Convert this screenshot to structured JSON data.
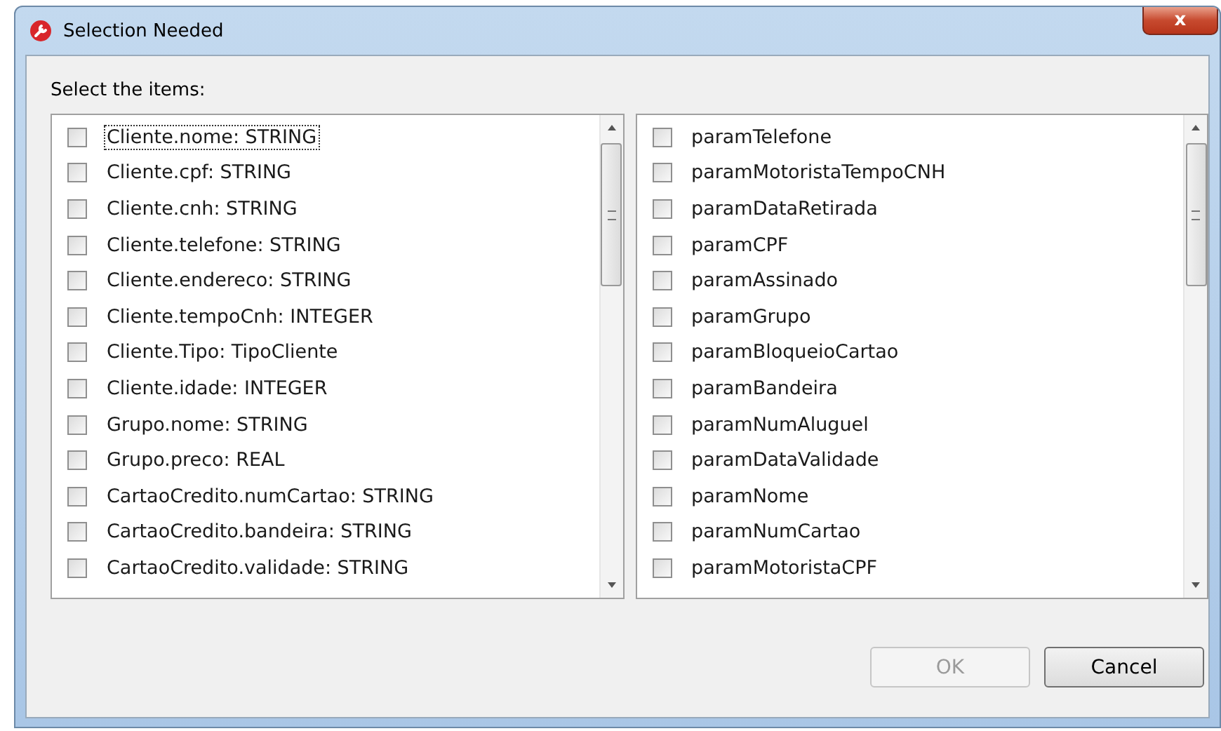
{
  "window": {
    "title": "Selection Needed",
    "close": "x"
  },
  "prompt": "Select the items:",
  "lists": [
    {
      "items": [
        {
          "label": "Cliente.nome: STRING",
          "checked": false,
          "focused": true
        },
        {
          "label": "Cliente.cpf: STRING",
          "checked": false,
          "focused": false
        },
        {
          "label": "Cliente.cnh: STRING",
          "checked": false,
          "focused": false
        },
        {
          "label": "Cliente.telefone: STRING",
          "checked": false,
          "focused": false
        },
        {
          "label": "Cliente.endereco: STRING",
          "checked": false,
          "focused": false
        },
        {
          "label": "Cliente.tempoCnh: INTEGER",
          "checked": false,
          "focused": false
        },
        {
          "label": "Cliente.Tipo: TipoCliente",
          "checked": false,
          "focused": false
        },
        {
          "label": "Cliente.idade: INTEGER",
          "checked": false,
          "focused": false
        },
        {
          "label": "Grupo.nome: STRING",
          "checked": false,
          "focused": false
        },
        {
          "label": "Grupo.preco: REAL",
          "checked": false,
          "focused": false
        },
        {
          "label": "CartaoCredito.numCartao: STRING",
          "checked": false,
          "focused": false
        },
        {
          "label": "CartaoCredito.bandeira: STRING",
          "checked": false,
          "focused": false
        },
        {
          "label": "CartaoCredito.validade: STRING",
          "checked": false,
          "focused": false
        }
      ]
    },
    {
      "items": [
        {
          "label": "paramTelefone",
          "checked": false,
          "focused": false
        },
        {
          "label": "paramMotoristaTempoCNH",
          "checked": false,
          "focused": false
        },
        {
          "label": "paramDataRetirada",
          "checked": false,
          "focused": false
        },
        {
          "label": "paramCPF",
          "checked": false,
          "focused": false
        },
        {
          "label": "paramAssinado",
          "checked": false,
          "focused": false
        },
        {
          "label": "paramGrupo",
          "checked": false,
          "focused": false
        },
        {
          "label": "paramBloqueioCartao",
          "checked": false,
          "focused": false
        },
        {
          "label": "paramBandeira",
          "checked": false,
          "focused": false
        },
        {
          "label": "paramNumAluguel",
          "checked": false,
          "focused": false
        },
        {
          "label": "paramDataValidade",
          "checked": false,
          "focused": false
        },
        {
          "label": "paramNome",
          "checked": false,
          "focused": false
        },
        {
          "label": "paramNumCartao",
          "checked": false,
          "focused": false
        },
        {
          "label": "paramMotoristaCPF",
          "checked": false,
          "focused": false
        }
      ]
    }
  ],
  "buttons": [
    {
      "label": "OK",
      "disabled": true
    },
    {
      "label": "Cancel",
      "disabled": false
    }
  ]
}
